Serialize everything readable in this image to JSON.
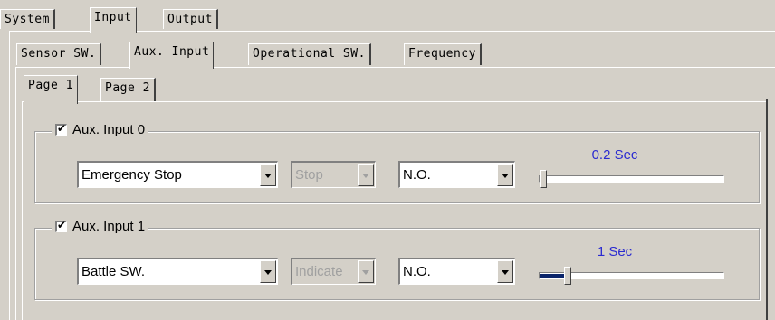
{
  "tabs_level1": [
    {
      "label": "System"
    },
    {
      "label": "Input"
    },
    {
      "label": "Output"
    }
  ],
  "tabs_level2": [
    {
      "label": "Sensor SW."
    },
    {
      "label": "Aux. Input"
    },
    {
      "label": "Operational SW."
    },
    {
      "label": "Frequency"
    }
  ],
  "tabs_level3": [
    {
      "label": "Page 1"
    },
    {
      "label": "Page 2"
    }
  ],
  "aux_inputs": [
    {
      "title": "Aux. Input 0",
      "checked": true,
      "function": "Emergency Stop",
      "action": "Stop",
      "contact": "N.O.",
      "delay_label": "0.2 Sec",
      "delay_fraction": 0.0
    },
    {
      "title": "Aux. Input 1",
      "checked": true,
      "function": "Battle SW.",
      "action": "Indicate",
      "contact": "N.O.",
      "delay_label": "1 Sec",
      "delay_fraction": 0.14
    }
  ],
  "colors": {
    "face": "#d4d0c8",
    "slider_label": "#2a2ad0",
    "slider_fill": "#0a246a"
  }
}
